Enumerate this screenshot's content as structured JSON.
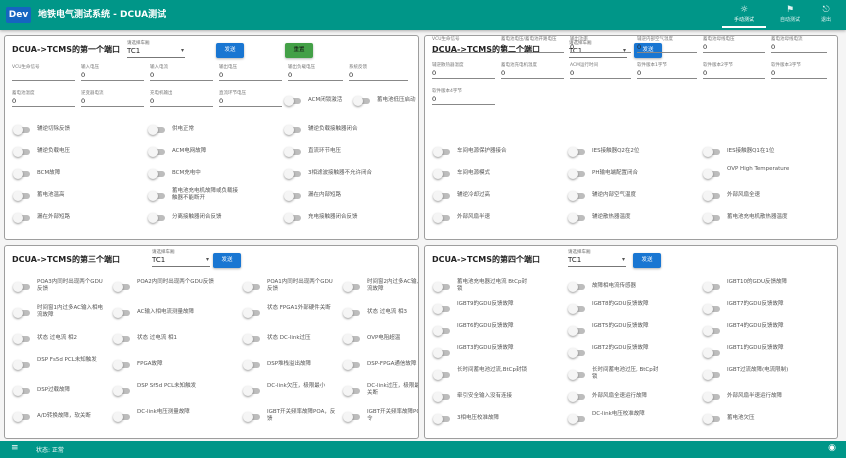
{
  "app": {
    "logo": "Dev",
    "title": "地铁电气测试系统 - DCUA测试"
  },
  "nav": [
    {
      "icon": "☼",
      "label": "手动测试"
    },
    {
      "icon": "⚑",
      "label": "自动测试"
    },
    {
      "icon": "⎋",
      "label": "退出"
    }
  ],
  "panels": [
    {
      "title": "DCUA->TCMS的第一个端口",
      "select": {
        "label": "请选择车厢",
        "value": "TC1"
      },
      "send_label": "发送",
      "reset_label": "重置",
      "fields": [
        [
          "VCU生命信号",
          "",
          "输入电压",
          "0",
          "输入电流",
          "0",
          "输出电压",
          "0",
          "输出负载电压",
          "0",
          "系统反馈",
          "0"
        ],
        [
          "蓄电池温度",
          "0",
          "逆变器电流",
          "0",
          "充电机输出",
          "0",
          "直流环节电压",
          "0"
        ]
      ],
      "switches": [
        "ACM闭锁激活",
        "蓄电池低压启动",
        "辅逆切除反馈",
        "供电正常",
        "辅逆负载接触器闭合",
        "辅逆负载电压",
        "ACM电网故障",
        "直流环节电压",
        "BCM故障",
        "BCM充电中",
        "3相滤波接触器不允许闭合",
        "蓄电池温高",
        "蓄电池充电机故障或负载接触器不能断开",
        "漏在内部短路",
        "漏在外部短路",
        "分离接触器闭合反馈",
        "充电接触器闭合反馈"
      ]
    },
    {
      "title": "DCUA->TCMS的第二个端口",
      "select": {
        "label": "请选择车厢",
        "value": "TC1"
      },
      "send_label": "发送",
      "fields": [
        [
          "VCU生命信号",
          "",
          "蓄电池电压/蓄电池开路电压",
          "0",
          "输出功率",
          "0",
          "辅逆内部空气温度",
          "0",
          "蓄电池母线电压",
          "0",
          "蓄电池母线电流",
          "0"
        ],
        [
          "辅逆散热器温度",
          "0",
          "蓄电池充电机温度",
          "0",
          "ACM运行时间",
          "0",
          "软件版本1字节",
          "0",
          "软件版本2字节",
          "0",
          "软件版本3字节",
          "0"
        ],
        [
          "软件版本4字节",
          "0"
        ]
      ],
      "switches": [
        "车间电源保护器接合",
        "IES接触器Q2在2位",
        "IES接触器Q1在1位",
        "车间电源模式",
        "PH输电端配置闭合",
        "OVP High Temperature",
        "辅逆冷却过高",
        "辅逆内部空气温度",
        "外部风扇全速",
        "外部风扇半速",
        "辅逆散热器温度",
        "蓄电池充电机散热器温度"
      ]
    },
    {
      "title": "DCUA->TCMS的第三个端口",
      "select": {
        "label": "请选择车厢",
        "value": "TC1"
      },
      "send_label": "发送",
      "switches": [
        "POA3内同时出现两个GDU反馈",
        "POA2内同时出现两个GDU反馈",
        "POA1内同时出现两个GDU反馈",
        "时间窗2内过多AC输入相电流故障",
        "时间窗1内过多AC输入相电流故障",
        "AC输入相电流测量故障",
        "状态 FPGA1外部硬件关断",
        "状态 过电流 相3",
        "状态 过电流 相2",
        "状态 过电流 相1",
        "状态 DC-link过压",
        "OVP电阻超温",
        "DSP Fs5d PCL未知触发",
        "FPGA故障",
        "DSP堆栈溢出故障",
        "DSP-FPGA通信故障",
        "DSP过载故障",
        "DSP Sf5d PCL未知触发",
        "DC-link欠压，极限最小",
        "DC-link过压，极限最大，软关断",
        "A/D转换故障，软关断",
        "DC-link电压测量故障",
        "IGBT开关频率故障POA，反馈",
        "IGBT开关频率故障POA，命令"
      ]
    },
    {
      "title": "DCUA->TCMS的第四个端口",
      "select": {
        "label": "请选择车厢",
        "value": "TC1"
      },
      "send_label": "发送",
      "switches": [
        "蓄电池充电器过电流 BtCp封锁",
        "故障相电流传感器",
        "IGBT10的GDU反馈故障",
        "IGBT9的GDU反馈故障",
        "IGBT8的GDU反馈故障",
        "IGBT7的GDU反馈故障",
        "IGBT6的GDU反馈故障",
        "IGBT5的GDU反馈故障",
        "IGBT4的GDU反馈故障",
        "IGBT3的GDU反馈故障",
        "IGBT2的GDU反馈故障",
        "IGBT1的GDU反馈故障",
        "长时间蓄电池过流,BtCp封锁",
        "长时间蓄电池过压, BtCp封锁",
        "IGBT过流故障(电流限制)",
        "牵引安全输入没有连接",
        "外部风扇全速运行故障",
        "外部风扇半速运行故障",
        "3相电压校准故障",
        "DC-link电压校准故障",
        "蓄电池欠压"
      ]
    }
  ],
  "bottom": {
    "menu_icon": "≡",
    "status": "状态: 正常",
    "eye_icon": "◉"
  }
}
